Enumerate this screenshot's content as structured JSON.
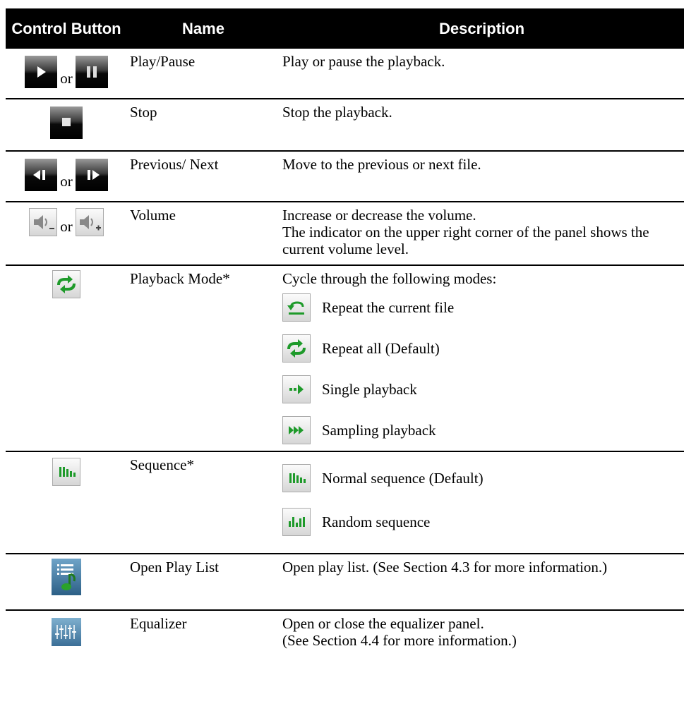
{
  "table": {
    "headers": {
      "control": "Control Button",
      "name": "Name",
      "description": "Description"
    },
    "or_text": "or",
    "rows": [
      {
        "name": "Play/Pause",
        "description": "Play or pause the playback."
      },
      {
        "name": "Stop",
        "description": "Stop the playback."
      },
      {
        "name": "Previous/ Next",
        "description": "Move to the previous or next file."
      },
      {
        "name": "Volume",
        "description_lines": [
          "Increase or decrease the volume.",
          "The indicator on the upper right corner of the panel shows the current volume level."
        ]
      },
      {
        "name": "Playback Mode*",
        "description": "Cycle through the following modes:",
        "modes": [
          "Repeat the current file",
          "Repeat all (Default)",
          "Single playback",
          "Sampling playback"
        ]
      },
      {
        "name": "Sequence*",
        "modes": [
          "Normal sequence (Default)",
          "Random sequence"
        ]
      },
      {
        "name": "Open Play List",
        "description": "Open play list. (See Section 4.3 for more information.)"
      },
      {
        "name": "Equalizer",
        "description_lines": [
          "Open or close the equalizer panel.",
          "(See Section 4.4 for more information.)"
        ]
      }
    ]
  },
  "icons": {
    "play": "play-icon",
    "pause": "pause-icon",
    "stop": "stop-icon",
    "previous": "previous-icon",
    "next": "next-icon",
    "volume_down": "volume-down-icon",
    "volume_up": "volume-up-icon",
    "repeat_all": "repeat-all-icon",
    "repeat_one": "repeat-one-icon",
    "single": "single-playback-icon",
    "sampling": "sampling-playback-icon",
    "normal_seq": "normal-sequence-icon",
    "random_seq": "random-sequence-icon",
    "playlist": "playlist-icon",
    "equalizer": "equalizer-icon"
  },
  "colors": {
    "header_bg": "#000000",
    "header_text": "#ffffff",
    "icon_green": "#1e9a2a",
    "icon_dark": "#111111"
  }
}
